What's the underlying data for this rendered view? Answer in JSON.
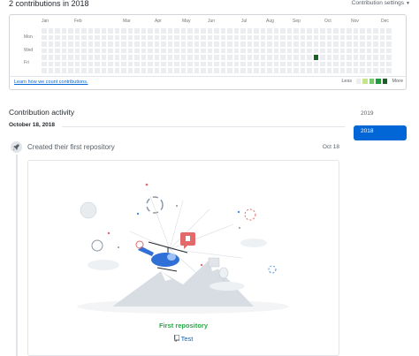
{
  "contributions": {
    "title": "2 contributions in 2018",
    "settings_label": "Contribution settings",
    "months": [
      "Jan",
      "Feb",
      "Mar",
      "Apr",
      "May",
      "Jun",
      "Jul",
      "Aug",
      "Sep",
      "Oct",
      "Nov",
      "Dec"
    ],
    "day_labels": [
      "Mon",
      "Wed",
      "Fri"
    ],
    "learn_link": "Learn how we count contributions.",
    "legend_less": "Less",
    "legend_more": "More",
    "colors": {
      "empty": "#ebedf0",
      "level_1": "#c6e48b",
      "level_2": "#7bc96f",
      "level_3": "#239a3b",
      "level_4": "#196127"
    }
  },
  "activity": {
    "heading": "Contribution activity",
    "years": [
      "2019",
      "2018"
    ],
    "selected_year": "2018",
    "date_label": "October 18, 2018",
    "event_title": "Created their first repository",
    "event_date": "Oct 18",
    "card_title": "First repository",
    "repo_name": "Test",
    "icons": {
      "event": "rocket-icon",
      "repo": "repo-icon"
    }
  }
}
